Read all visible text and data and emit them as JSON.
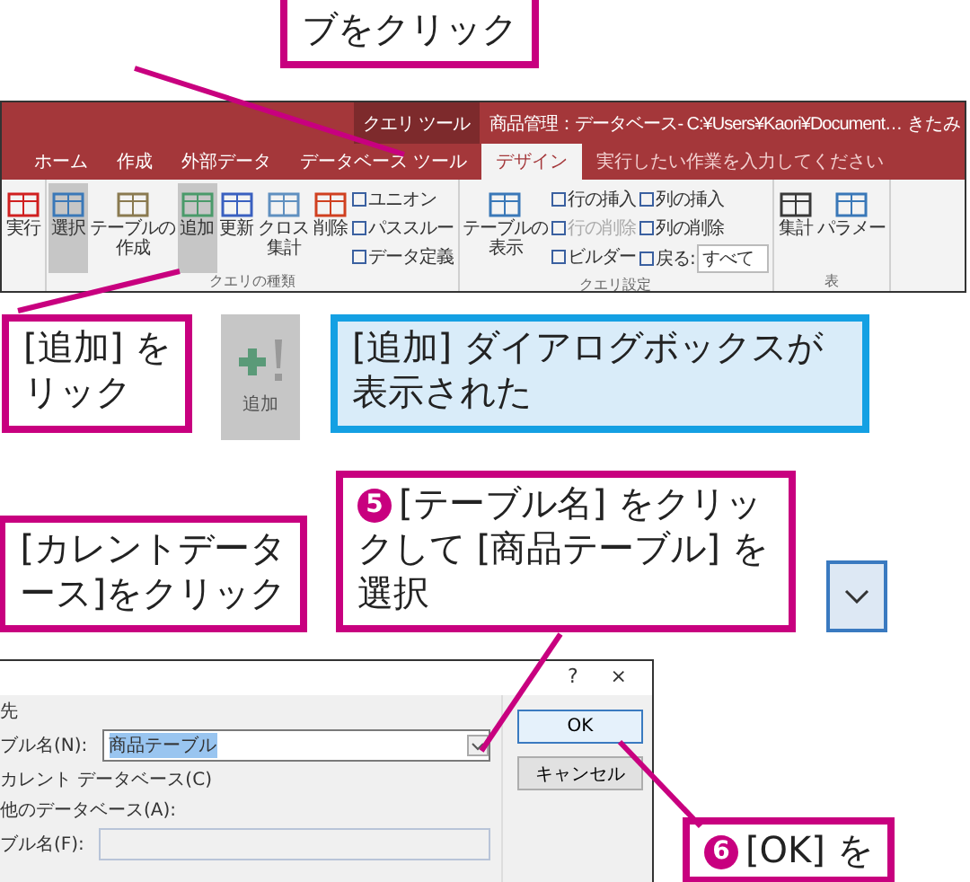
{
  "callouts": [
    {
      "kind": "step",
      "lines": [
        "ブをクリック"
      ]
    },
    {
      "kind": "step",
      "lines": [
        "[追加] を",
        "リック"
      ]
    },
    {
      "kind": "note",
      "lines": [
        "[追加] ダイアログボックスが",
        "表示された"
      ]
    },
    {
      "kind": "step",
      "lines": [
        "[カレントデータ",
        "ース]をクリック"
      ]
    },
    {
      "kind": "step",
      "step": "5",
      "lines": [
        "[テーブル名] をクリッ",
        "クして [商品テーブル] を",
        "選択"
      ]
    },
    {
      "kind": "step",
      "step": "6",
      "lines": [
        "[OK] を"
      ]
    }
  ],
  "ribbon": {
    "context_label": "クエリ ツール",
    "title": "商品管理：データベース- C:¥Users¥Kaori¥Document…",
    "account": "きたみ",
    "tabs": [
      {
        "label": "ホーム",
        "selected": false
      },
      {
        "label": "作成",
        "selected": false
      },
      {
        "label": "外部データ",
        "selected": false
      },
      {
        "label": "データベース ツール",
        "selected": false
      },
      {
        "label": "デザイン",
        "selected": true
      }
    ],
    "tell_me": "実行したい作業を入力してください",
    "groups": [
      {
        "items": [
          {
            "kind": "large",
            "lines": [
              "実行"
            ],
            "selected": false
          }
        ]
      },
      {
        "label": "クエリの種類",
        "items": [
          {
            "kind": "large",
            "lines": [
              "選択"
            ],
            "selected": true
          },
          {
            "kind": "large",
            "lines": [
              "テーブルの",
              "作成"
            ],
            "selected": false
          },
          {
            "kind": "large",
            "lines": [
              "追加"
            ],
            "selected": true
          },
          {
            "kind": "large",
            "lines": [
              "更新"
            ],
            "selected": false
          },
          {
            "kind": "large",
            "lines": [
              "クロス",
              "集計"
            ],
            "selected": false
          },
          {
            "kind": "large",
            "lines": [
              "削除"
            ],
            "selected": false
          },
          {
            "kind": "stack",
            "rows": [
              {
                "label": "ユニオン",
                "disabled": false
              },
              {
                "label": "パススルー",
                "disabled": false
              },
              {
                "label": "データ定義",
                "disabled": false
              }
            ]
          }
        ]
      },
      {
        "label": "クエリ設定",
        "items": [
          {
            "kind": "large",
            "lines": [
              "テーブルの",
              "表示"
            ],
            "selected": false
          },
          {
            "kind": "stack",
            "rows": [
              {
                "label": "行の挿入",
                "disabled": false
              },
              {
                "label": "行の削除",
                "disabled": true
              },
              {
                "label": "ビルダー",
                "disabled": false
              }
            ]
          },
          {
            "kind": "stack",
            "rows": [
              {
                "label": "列の挿入",
                "disabled": false
              },
              {
                "label": "列の削除",
                "disabled": false
              },
              {
                "label": "戻る:",
                "disabled": false,
                "combo": "すべて"
              }
            ]
          }
        ]
      },
      {
        "label": "表",
        "items": [
          {
            "kind": "large",
            "lines": [
              "集計"
            ],
            "selected": false
          },
          {
            "kind": "large",
            "lines": [
              "パラメー"
            ],
            "selected": false
          }
        ]
      }
    ]
  },
  "zoom_tile": {
    "label": "追加"
  },
  "dialog": {
    "help": "?",
    "close": "×",
    "section": "先",
    "table_label": "ブル名(N):",
    "table_value": "商品テーブル",
    "options": [
      "カレント データベース(C)",
      "他のデータベース(A):"
    ],
    "file_label": "ブル名(F):",
    "buttons": [
      {
        "label": "OK",
        "focused": true
      },
      {
        "label": "キャンセル",
        "focused": false
      }
    ]
  }
}
